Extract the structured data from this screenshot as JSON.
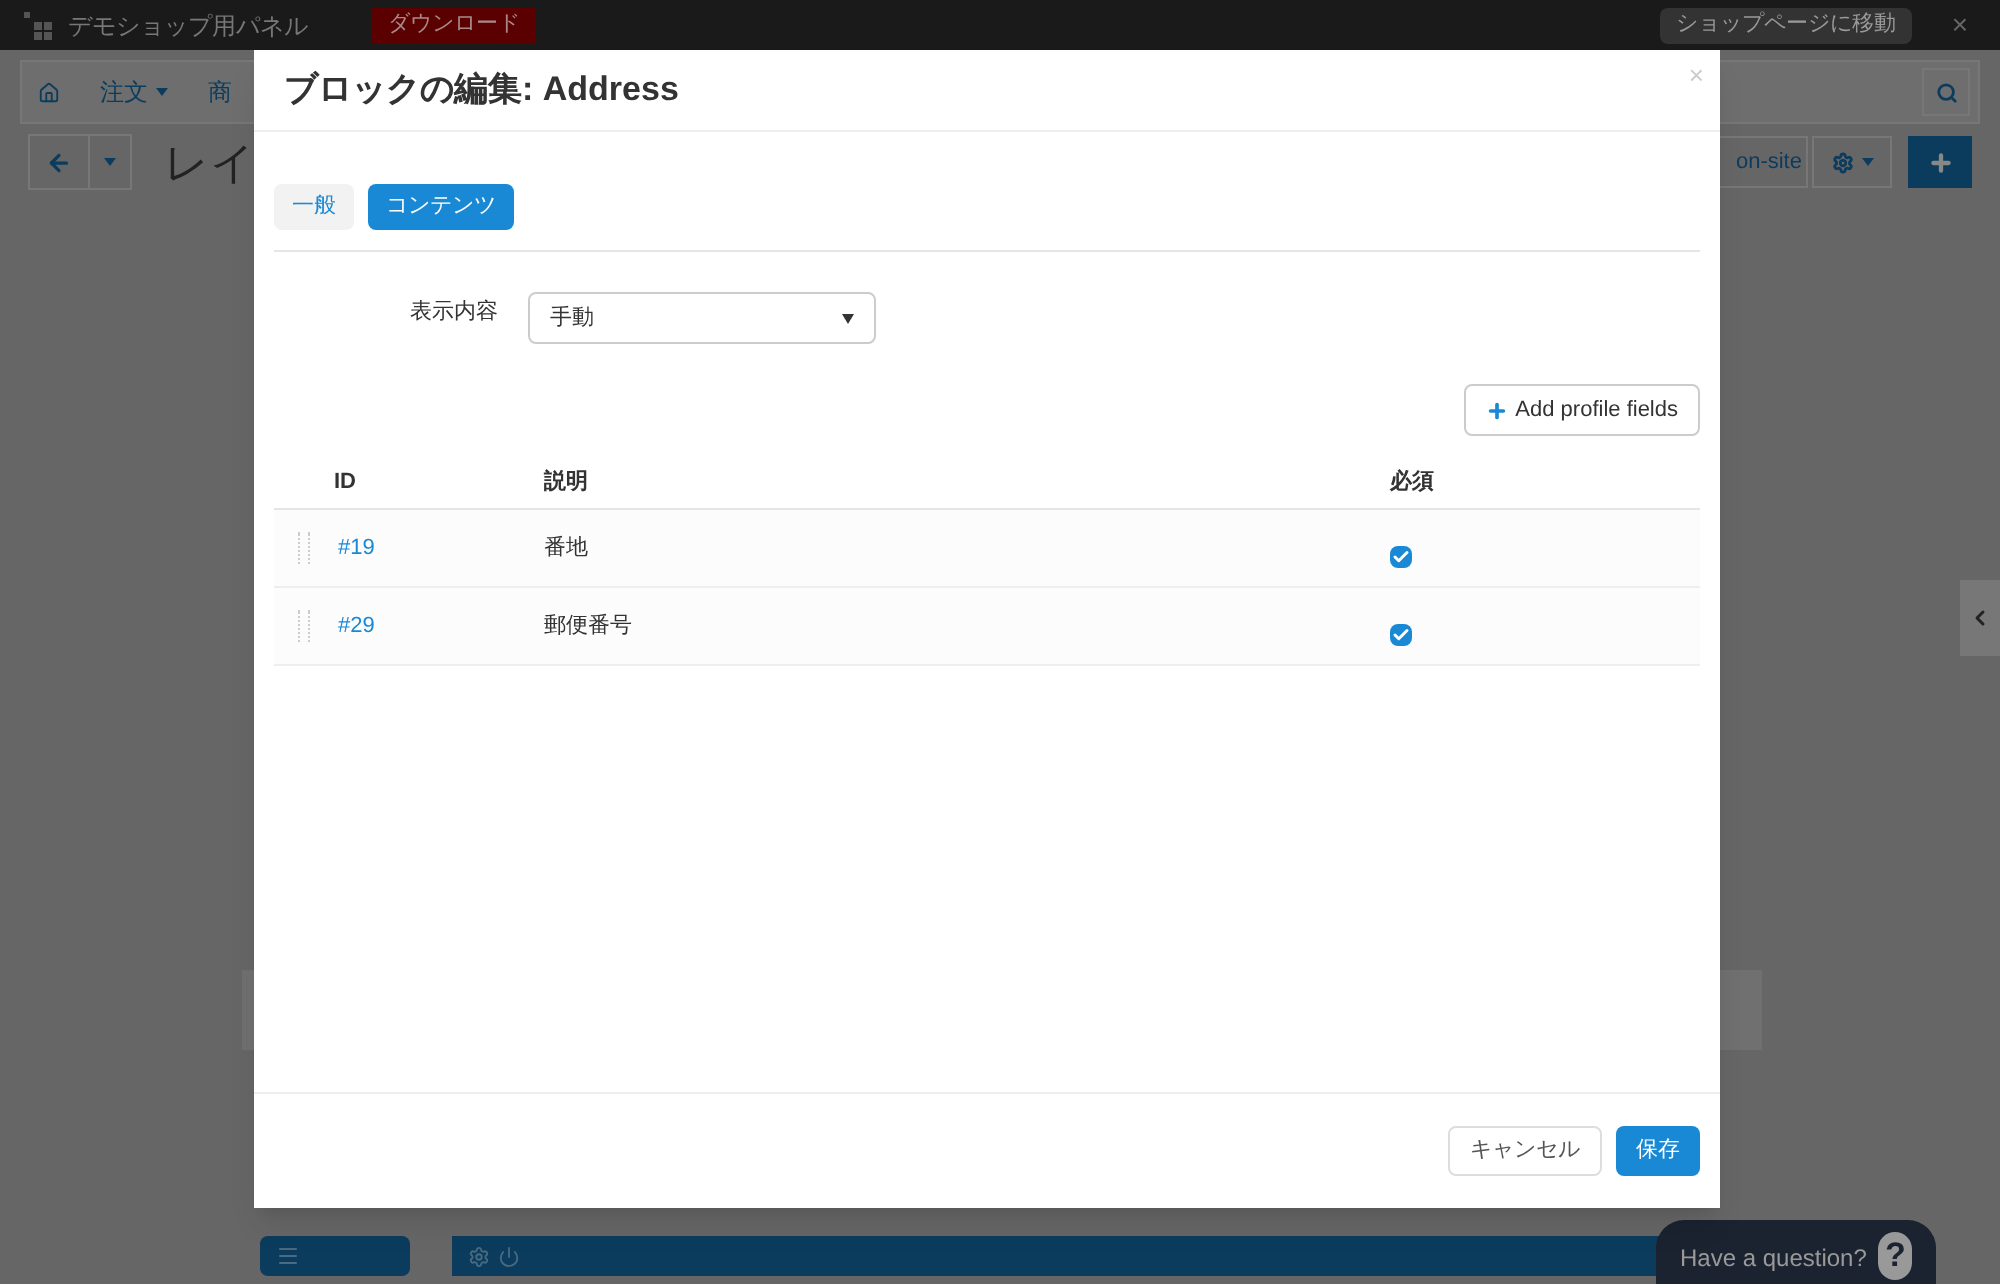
{
  "topbar": {
    "title": "デモショップ用パネル",
    "download": "ダウンロード",
    "shop_link": "ショップページに移動",
    "close": "×"
  },
  "nav": {
    "items": [
      {
        "label": "注文",
        "caret": true
      },
      {
        "label": "商",
        "caret": false
      }
    ],
    "page_title": "レイ",
    "onsite": "on-site"
  },
  "modal": {
    "title": "ブロックの編集: Address",
    "close": "×",
    "tabs": [
      {
        "label": "一般",
        "selected": false
      },
      {
        "label": "コンテンツ",
        "selected": true
      }
    ],
    "field": {
      "label": "表示内容",
      "value": "手動"
    },
    "add_button": "Add profile fields",
    "table": {
      "columns": [
        "ID",
        "説明",
        "必須"
      ],
      "rows": [
        {
          "id": "#19",
          "description": "番地",
          "required": true
        },
        {
          "id": "#29",
          "description": "郵便番号",
          "required": true
        }
      ]
    },
    "buttons": {
      "cancel": "キャンセル",
      "save": "保存"
    }
  },
  "help": {
    "label": "Have a question?",
    "icon": "?"
  }
}
